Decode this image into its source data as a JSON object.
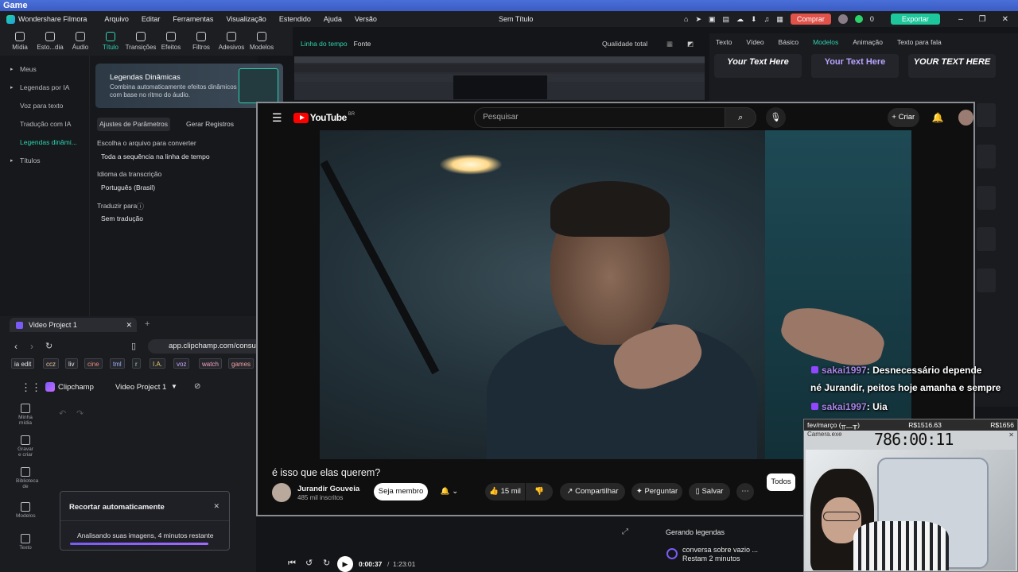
{
  "game_bar": {
    "title": "Game"
  },
  "menubar": {
    "app_name": "Wondershare Filmora",
    "items": [
      "Arquivo",
      "Editar",
      "Ferramentas",
      "Visualização",
      "Estendido",
      "Ajuda",
      "Versão"
    ],
    "window_title": "Sem Título",
    "buy": "Comprar",
    "credits": "0",
    "export": "Exportar"
  },
  "toolbar": {
    "tools": [
      {
        "label": "Mídia",
        "icon": "media-icon"
      },
      {
        "label": "Esto...dia",
        "icon": "stock-icon"
      },
      {
        "label": "Áudio",
        "icon": "audio-icon"
      },
      {
        "label": "Título",
        "icon": "title-icon"
      },
      {
        "label": "Transições",
        "icon": "transition-icon"
      },
      {
        "label": "Efeitos",
        "icon": "effects-icon"
      },
      {
        "label": "Filtros",
        "icon": "filter-icon"
      },
      {
        "label": "Adesivos",
        "icon": "sticker-icon"
      },
      {
        "label": "Modelos",
        "icon": "template-icon"
      }
    ]
  },
  "sidenav": {
    "items": [
      "Meus",
      "Legendas por IA",
      "Voz para texto",
      "Tradução com IA",
      "Legendas dinâmi...",
      "Títulos"
    ]
  },
  "panel": {
    "promo_title": "Legendas Dinâmicas",
    "promo_desc": "Combina automaticamente efeitos dinâmicos com base no ritmo do áudio.",
    "tab_params": "Ajustes de Parâmetros",
    "tab_generate": "Gerar Registros",
    "choose_label": "Escolha o arquivo para converter",
    "choose_value": "Toda a sequência na linha de tempo",
    "lang_label": "Idioma da transcrição",
    "lang_value": "Português (Brasil)",
    "translate_label": "Traduzir para",
    "translate_value": "Sem tradução"
  },
  "preview": {
    "tab_timeline": "Linha do tempo",
    "tab_source": "Fonte",
    "quality": "Qualidade total"
  },
  "right_panel": {
    "tabs": [
      "Texto",
      "Vídeo",
      "Básico",
      "Modelos",
      "Animação",
      "Texto para fala"
    ],
    "cards": [
      "Your Text Here",
      "Your Text Here",
      "YOUR TEXT HERE"
    ]
  },
  "youtube": {
    "brand": "YouTube",
    "region": "BR",
    "search_placeholder": "Pesquisar",
    "create": "Criar",
    "video_title": "é isso que elas querem?",
    "channel": "Jurandir Gouveia",
    "subscribers": "485 mil inscritos",
    "join": "Seja membro",
    "likes": "15 mil",
    "share": "Compartilhar",
    "ask": "Perguntar",
    "save": "Salvar",
    "filter_all": "Todos"
  },
  "browser": {
    "tab_title": "Video Project 1",
    "url": "app.clipchamp.com/consu",
    "bookmarks": [
      "ia edit",
      "ccz",
      "liv",
      "cine",
      "tml",
      "r",
      "I.A.",
      "voz",
      "watch",
      "games"
    ],
    "app_name": "Clipchamp",
    "project": "Video Project 1",
    "nav": [
      "Minha mídia",
      "Gravar e criar",
      "Biblioteca de",
      "Modelos",
      "Texto"
    ]
  },
  "toast": {
    "title": "Recortar automaticamente",
    "status": "Analisando suas imagens, 4 minutos restante",
    "progress": 1.0
  },
  "timeline": {
    "current": "0:00:37",
    "total": "1:23:01"
  },
  "captions": {
    "title": "Gerando legendas",
    "item": "conversa sobre vazio ...",
    "remaining": "Restam 2 minutos"
  },
  "chat": [
    {
      "user": "sakai1997",
      "text": ": Desnecessário depende"
    },
    {
      "user": "",
      "text": "né Jurandir, peitos hoje amanha e sempre"
    },
    {
      "user": "sakai1997",
      "text": ": Uia"
    }
  ],
  "cam": {
    "period": "fev/março",
    "face": "(╥﹏╥)",
    "money_left": "R$1516.63",
    "money_right": "R$1656",
    "exe": "Camera.exe",
    "timer": "786:00:11"
  },
  "colors": {
    "accent": "#2bd4b0",
    "youtube_red": "#ff0000",
    "buy": "#e0524a",
    "export": "#1ec79b",
    "clipchamp": "#7a5bf5"
  }
}
